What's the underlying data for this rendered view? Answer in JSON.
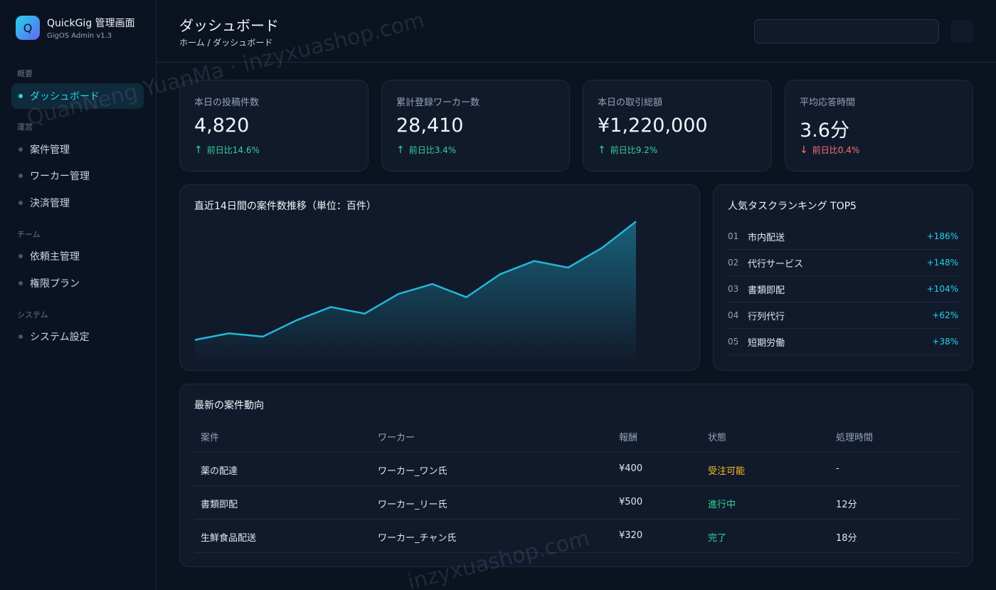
{
  "brand": {
    "logo": "Q",
    "name": "QuickGig 管理画面",
    "version": "GigOS Admin v1.3"
  },
  "sidebar": {
    "sections": [
      {
        "label": "概要",
        "items": [
          {
            "label": "ダッシュボード",
            "active": true
          }
        ]
      },
      {
        "label": "運営",
        "items": [
          {
            "label": "案件管理"
          },
          {
            "label": "ワーカー管理"
          },
          {
            "label": "決済管理"
          }
        ]
      },
      {
        "label": "チーム",
        "items": [
          {
            "label": "依頼主管理"
          },
          {
            "label": "権限プラン"
          }
        ]
      },
      {
        "label": "システム",
        "items": [
          {
            "label": "システム設定"
          }
        ]
      }
    ]
  },
  "header": {
    "title": "ダッシュボード",
    "breadcrumb": "ホーム / ダッシュボード"
  },
  "stats": [
    {
      "label": "本日の投稿件数",
      "value": "4,820",
      "arrow": "↑",
      "delta": "前日比14.6%",
      "trend": "up"
    },
    {
      "label": "累計登録ワーカー数",
      "value": "28,410",
      "arrow": "↑",
      "delta": "前日比3.4%",
      "trend": "up"
    },
    {
      "label": "本日の取引総額",
      "value": "¥1,220,000",
      "arrow": "↑",
      "delta": "前日比9.2%",
      "trend": "up"
    },
    {
      "label": "平均応答時間",
      "value": "3.6分",
      "arrow": "↓",
      "delta": "前日比0.4%",
      "trend": "down"
    }
  ],
  "trend_card": {
    "title": "直近14日間の案件数推移（単位：百件）"
  },
  "chart_data": {
    "type": "area",
    "title": "直近14日間の案件数推移（単位：百件）",
    "x": [
      1,
      2,
      3,
      4,
      5,
      6,
      7,
      8,
      9,
      10,
      11,
      12,
      13,
      14
    ],
    "values": [
      14,
      18,
      16,
      26,
      34,
      30,
      42,
      48,
      40,
      54,
      62,
      58,
      70,
      86
    ],
    "ylim": [
      0,
      90
    ],
    "grid": false,
    "color": "#22b8d8"
  },
  "ranking": {
    "title": "人気タスクランキング TOP5",
    "items": [
      {
        "no": "01",
        "name": "市内配送",
        "value": "+186%"
      },
      {
        "no": "02",
        "name": "代行サービス",
        "value": "+148%"
      },
      {
        "no": "03",
        "name": "書類即配",
        "value": "+104%"
      },
      {
        "no": "04",
        "name": "行列代行",
        "value": "+62%"
      },
      {
        "no": "05",
        "name": "短期労働",
        "value": "+38%"
      }
    ]
  },
  "table": {
    "title": "最新の案件動向",
    "columns": [
      "案件",
      "ワーカー",
      "報酬",
      "状態",
      "処理時間"
    ],
    "rows": [
      {
        "task": "薬の配達",
        "worker": "ワーカー_ワン氏",
        "reward": "¥400",
        "status": "受注可能",
        "status_kind": "open",
        "time": "-"
      },
      {
        "task": "書類即配",
        "worker": "ワーカー_リー氏",
        "reward": "¥500",
        "status": "進行中",
        "status_kind": "prog",
        "time": "12分"
      },
      {
        "task": "生鮮食品配送",
        "worker": "ワーカー_チャン氏",
        "reward": "¥320",
        "status": "完了",
        "status_kind": "done",
        "time": "18分"
      }
    ]
  },
  "watermarks": [
    "QuanNeng YuanMa · inzyxuashop.com",
    "inzyxuashop.com"
  ]
}
